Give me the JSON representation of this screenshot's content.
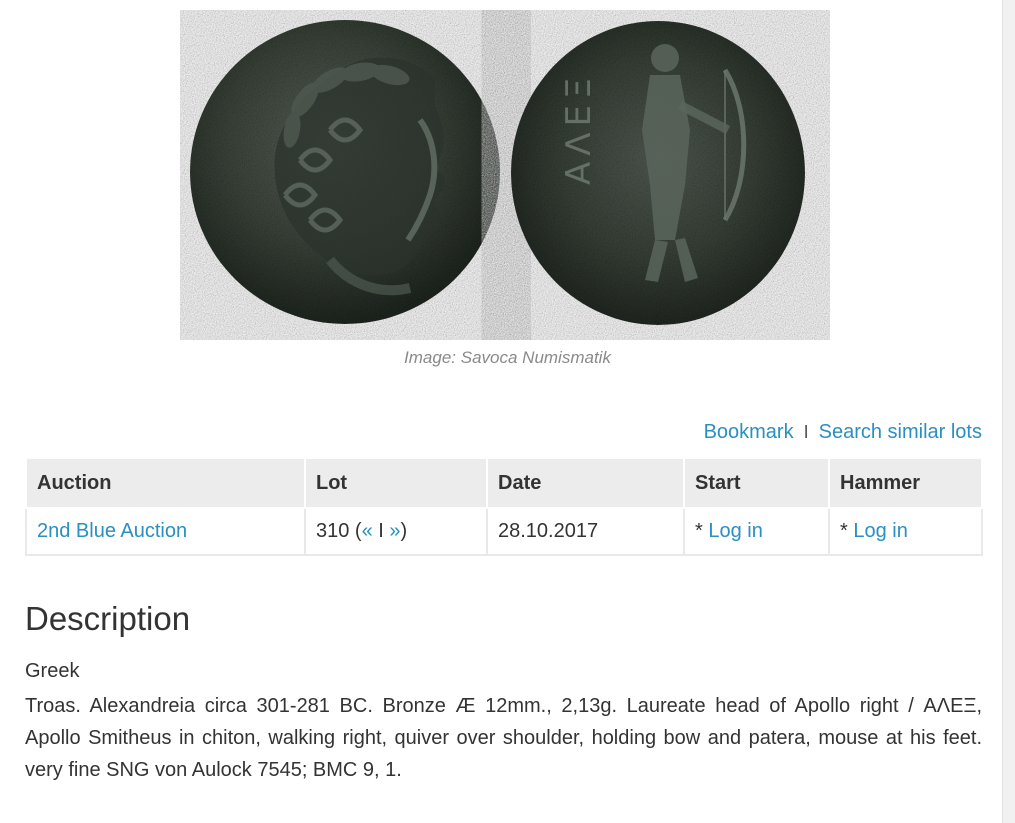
{
  "image": {
    "caption": "Image: Savoca Numismatik"
  },
  "actions": {
    "bookmark": "Bookmark",
    "separator": "I",
    "search_similar": "Search similar lots"
  },
  "table": {
    "headers": [
      "Auction",
      "Lot",
      "Date",
      "Start",
      "Hammer"
    ],
    "row": {
      "auction": "2nd Blue Auction",
      "lot_number": "310",
      "lot_open": " (",
      "lot_prev": "«",
      "lot_sep": " I ",
      "lot_next": "»",
      "lot_close": ")",
      "date": "28.10.2017",
      "start_prefix": "* ",
      "start_link": "Log in",
      "hammer_prefix": "* ",
      "hammer_link": "Log in"
    }
  },
  "description": {
    "title": "Description",
    "category": "Greek",
    "text": "Troas. Alexandreia circa 301-281 BC. Bronze Æ 12mm., 2,13g. Laureate head of Apollo right / ΑΛΕΞ, Apollo Smitheus in chiton, walking right, quiver over shoulder, holding bow and patera, mouse at his feet. very fine SNG von Aulock 7545; BMC 9, 1."
  },
  "coin": {
    "reverse_legend": "ΑΛΕΞ",
    "colors": {
      "bronze_dark": "#1f2620",
      "bronze_mid": "#3d463c",
      "bronze_light": "#59625a"
    }
  }
}
